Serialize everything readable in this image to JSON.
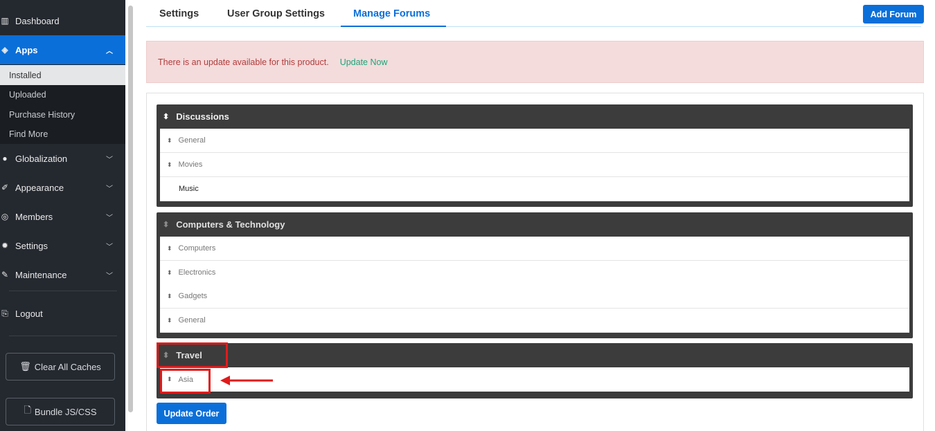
{
  "sidebar": {
    "dashboard": "Dashboard",
    "apps": "Apps",
    "apps_sub": [
      "Installed",
      "Uploaded",
      "Purchase History",
      "Find More"
    ],
    "globalization": "Globalization",
    "appearance": "Appearance",
    "members": "Members",
    "settings": "Settings",
    "maintenance": "Maintenance",
    "logout": "Logout",
    "clear_caches": "Clear All Caches",
    "bundle": "Bundle JS/CSS"
  },
  "tabs": {
    "settings": "Settings",
    "user_group_settings": "User Group Settings",
    "manage_forums": "Manage Forums",
    "active": "Manage Forums"
  },
  "add_forum": "Add Forum",
  "alert": {
    "text": "There is an update available for this product.",
    "link": "Update Now"
  },
  "categories": [
    {
      "name": "Discussions",
      "forums": [
        "General",
        "Movies",
        "Music"
      ]
    },
    {
      "name": "Computers & Technology",
      "forums": [
        "Computers",
        "Electronics",
        "Gadgets",
        "General"
      ]
    },
    {
      "name": "Travel",
      "forums": [
        "Asia"
      ]
    }
  ],
  "update_order": "Update Order",
  "colors": {
    "primary": "#0b6fd9",
    "sidebar_bg": "#24282f",
    "category_bg": "#3c3c3c",
    "highlight": "#e01b1b",
    "alert_bg": "#f4dcdc"
  }
}
